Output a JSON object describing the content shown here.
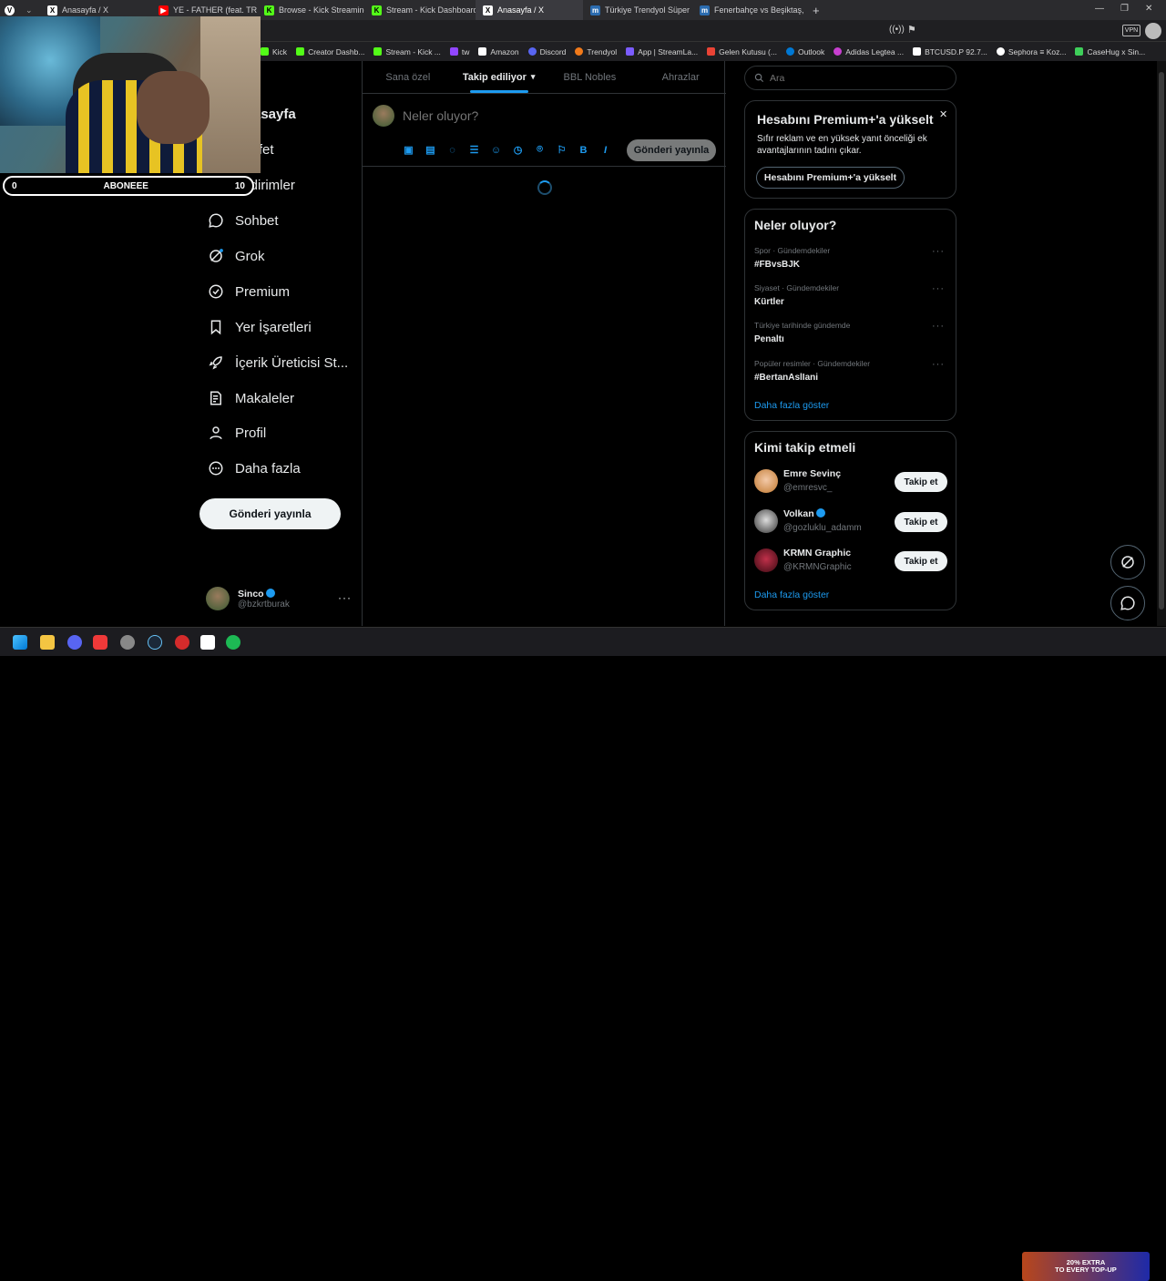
{
  "browser": {
    "tabs": [
      {
        "label": "Anasayfa / X",
        "icon": "x-logo",
        "color": "#ffffff",
        "active": false
      },
      {
        "label": "YE - FATHER (feat. TRAVIS S",
        "icon": "youtube-logo",
        "color": "#ff0000",
        "active": false
      },
      {
        "label": "Browse - Kick Streaming",
        "icon": "kick-logo",
        "color": "#53fc18",
        "active": false
      },
      {
        "label": "Stream - Kick Dashboard",
        "icon": "kick-logo",
        "color": "#53fc18",
        "active": false
      },
      {
        "label": "Anasayfa / X",
        "icon": "x-logo",
        "color": "#ffffff",
        "active": true
      },
      {
        "label": "Türkiye Trendyol Süper Lig",
        "icon": "m-logo",
        "color": "#2b6cb0",
        "active": false
      },
      {
        "label": "Fenerbahçe vs Beşiktaş, 05.",
        "icon": "m-logo",
        "color": "#2b6cb0",
        "active": false
      }
    ],
    "new_tab": "+",
    "bookmarks": [
      {
        "label": "Kick",
        "color": "#53fc18"
      },
      {
        "label": "Creator Dashb...",
        "color": "#53fc18"
      },
      {
        "label": "Stream - Kick ...",
        "color": "#53fc18"
      },
      {
        "label": "tw",
        "color": "#9146ff"
      },
      {
        "label": "Amazon",
        "color": "#ffffff"
      },
      {
        "label": "Discord",
        "color": "#5865f2"
      },
      {
        "label": "Trendyol",
        "color": "#f27a1a"
      },
      {
        "label": "App | StreamLa...",
        "color": "#7b5cff"
      },
      {
        "label": "Gelen Kutusu (...",
        "color": "#ea4335"
      },
      {
        "label": "Outlook",
        "color": "#0078d4"
      },
      {
        "label": "Adidas Legtea ...",
        "color": "#c83fd0"
      },
      {
        "label": "BTCUSD.P 92.7...",
        "color": "#ffffff"
      },
      {
        "label": "Sephora ≡ Koz...",
        "color": "#ffffff"
      },
      {
        "label": "CaseHug x Sin...",
        "color": "#3ecf5a"
      }
    ],
    "vpn_badge": "VPN"
  },
  "stream_overlay": {
    "count": "0",
    "label": "ABONEEE",
    "goal": "10"
  },
  "nav": {
    "items": [
      {
        "label": "Anasayfa",
        "icon": "home-icon"
      },
      {
        "label": "Keşfet",
        "icon": "search-icon"
      },
      {
        "label": "Bildirimler",
        "icon": "bell-icon"
      },
      {
        "label": "Sohbet",
        "icon": "chat-icon"
      },
      {
        "label": "Grok",
        "icon": "grok-icon"
      },
      {
        "label": "Premium",
        "icon": "premium-icon"
      },
      {
        "label": "Yer İşaretleri",
        "icon": "bookmark-icon"
      },
      {
        "label": "İçerik Üreticisi St...",
        "icon": "rocket-icon"
      },
      {
        "label": "Makaleler",
        "icon": "article-icon"
      },
      {
        "label": "Profil",
        "icon": "person-icon"
      },
      {
        "label": "Daha fazla",
        "icon": "more-circle-icon"
      }
    ],
    "post_button": "Gönderi yayınla",
    "account": {
      "name": "Sinco",
      "handle": "@bzkrtburak"
    }
  },
  "feed": {
    "tabs": [
      "Sana özel",
      "Takip ediliyor",
      "BBL Nobles",
      "Ahrazlar"
    ],
    "selected_tab": 1,
    "composer_placeholder": "Neler oluyor?",
    "publish_button": "Gönderi yayınla"
  },
  "sidebar": {
    "search_placeholder": "Ara",
    "premium": {
      "title": "Hesabını Premium+'a yükselt",
      "body": "Sıfır reklam ve en yüksek yanıt önceliği ek avantajlarının tadını çıkar.",
      "button": "Hesabını Premium+'a yükselt"
    },
    "trends": {
      "title": "Neler oluyor?",
      "items": [
        {
          "meta": "Spor · Gündemdekiler",
          "name": "#FBvsBJK"
        },
        {
          "meta": "Siyaset · Gündemdekiler",
          "name": "Kürtler"
        },
        {
          "meta": "Türkiye tarihinde gündemde",
          "name": "Penaltı"
        },
        {
          "meta": "Popüler resimler · Gündemdekiler",
          "name": "#BertanAslIani"
        }
      ],
      "more": "Daha fazla göster"
    },
    "who_to_follow": {
      "title": "Kimi takip etmeli",
      "items": [
        {
          "name": "Emre Sevinç",
          "handle": "@emresvc_",
          "verified": false,
          "button": "Takip et"
        },
        {
          "name": "Volkan",
          "handle": "@gozluklu_adamm",
          "verified": true,
          "button": "Takip et"
        },
        {
          "name": "KRMN Graphic",
          "handle": "@KRMNGraphic",
          "verified": false,
          "button": "Takip et"
        }
      ],
      "more": "Daha fazla göster"
    }
  },
  "promo": {
    "line1": "20% EXTRA",
    "line2": "TO EVERY TOP-UP"
  },
  "colors": {
    "accent": "#1d9bf0",
    "background": "#000000",
    "border": "#2f3336",
    "muted": "#71767b"
  }
}
